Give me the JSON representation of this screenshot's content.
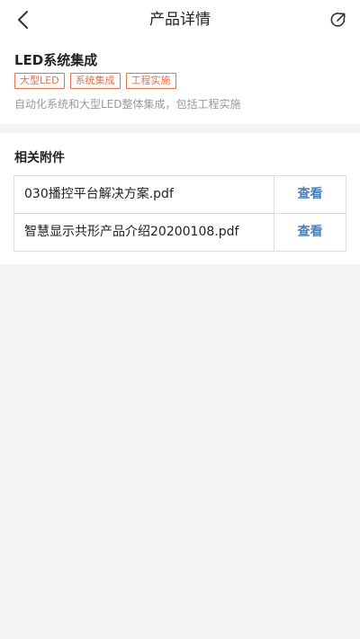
{
  "header": {
    "title": "产品详情",
    "back_icon": "chevron-left-icon",
    "share_icon": "share-icon"
  },
  "product": {
    "name": "LED系统集成",
    "tags": [
      "大型LED",
      "系统集成",
      "工程实施"
    ],
    "description": "自动化系统和大型LED整体集成，包括工程实施"
  },
  "attachments": {
    "title": "相关附件",
    "items": [
      {
        "filename": "030播控平台解决方案.pdf",
        "action": "查看"
      },
      {
        "filename": "智慧显示共形产品介绍20200108.pdf",
        "action": "查看"
      }
    ]
  },
  "colors": {
    "tag": "#e2734b",
    "link": "#4a7fb5",
    "background": "#f4f4f4"
  }
}
